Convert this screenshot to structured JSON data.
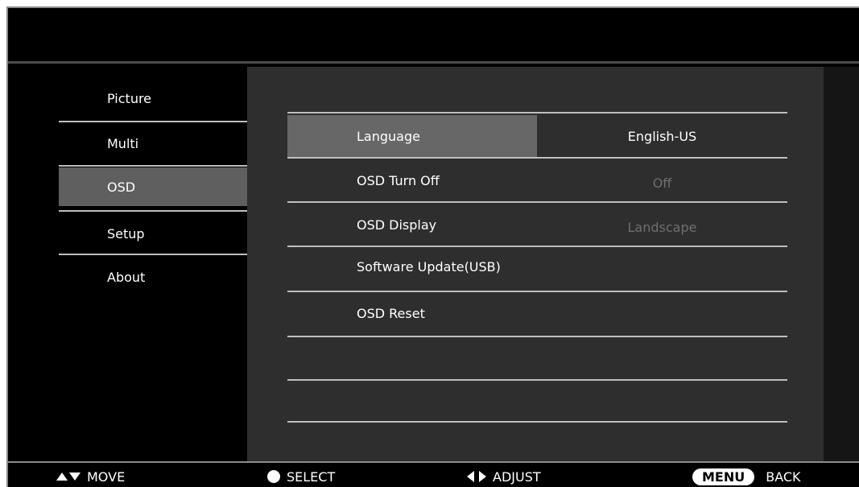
{
  "sidebar": {
    "items": [
      {
        "label": "Picture"
      },
      {
        "label": "Multi"
      },
      {
        "label": "OSD"
      },
      {
        "label": "Setup"
      },
      {
        "label": "About"
      }
    ],
    "active": "OSD"
  },
  "settings": {
    "rows": [
      {
        "label": "Language",
        "value": "English-US"
      },
      {
        "label": "OSD Turn Off",
        "value": "Off"
      },
      {
        "label": "OSD Display",
        "value": "Landscape"
      },
      {
        "label": "Software Update(USB)",
        "value": ""
      },
      {
        "label": "OSD Reset",
        "value": ""
      }
    ],
    "selected": "Language"
  },
  "hints": {
    "move": "MOVE",
    "select": "SELECT",
    "adjust": "ADJUST",
    "menu_key": "MENU",
    "back": "BACK"
  },
  "colors": {
    "background": "#000000",
    "panel": "#2e2e2e",
    "active_item": "#5f5f5f",
    "selected_row": "#676767",
    "dim_value": "#6f6f6f"
  },
  "icons": {
    "move": "up-down-arrows-icon",
    "select": "circle-icon",
    "adjust": "left-right-arrows-icon"
  }
}
